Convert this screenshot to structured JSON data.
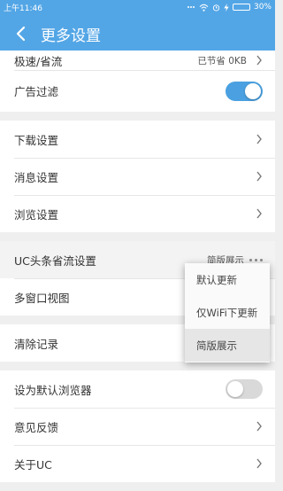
{
  "status_bar": {
    "time": "上午11:46",
    "battery": "30%",
    "battery_level": 0.3
  },
  "header": {
    "title": "更多设置"
  },
  "sections": {
    "speed": {
      "label": "极速/省流",
      "value": "已节省 0KB"
    },
    "ad_filter": {
      "label": "广告过滤",
      "enabled": true
    },
    "download": {
      "label": "下载设置"
    },
    "message": {
      "label": "消息设置"
    },
    "browse": {
      "label": "浏览设置"
    },
    "uc_headline": {
      "label": "UC头条省流设置",
      "value": "简版展示"
    },
    "multiwindow": {
      "label": "多窗口视图"
    },
    "clear": {
      "label": "清除记录"
    },
    "default_browser": {
      "label": "设为默认浏览器",
      "enabled": false
    },
    "feedback": {
      "label": "意见反馈"
    },
    "about": {
      "label": "关于UC"
    }
  },
  "popup_menu": {
    "options": [
      "默认更新",
      "仅WiFi下更新",
      "简版展示"
    ],
    "selected": "简版展示"
  },
  "colors": {
    "accent": "#53a6e6",
    "toggle_on": "#4aa0e0"
  }
}
